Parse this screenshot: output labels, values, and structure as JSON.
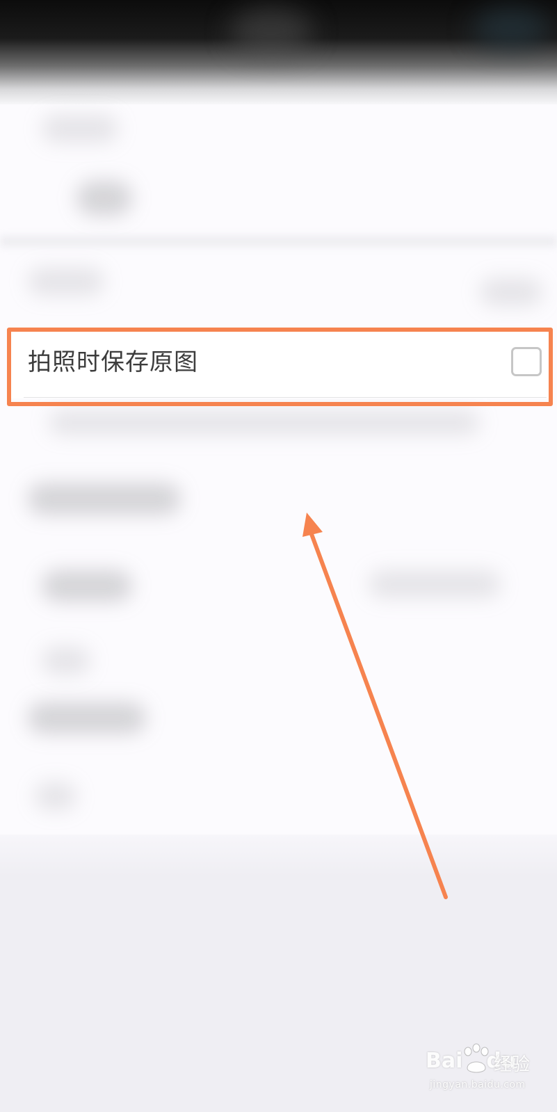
{
  "settings": {
    "focused_item": {
      "label": "拍照时保存原图",
      "checked": false
    }
  },
  "annotation": {
    "highlight_color": "#f6834f",
    "arrow_color": "#f6834f"
  },
  "watermark": {
    "logo_text": "Bai",
    "logo_text2": "du",
    "brand": "经验",
    "url": "jingyan.baidu.com"
  }
}
